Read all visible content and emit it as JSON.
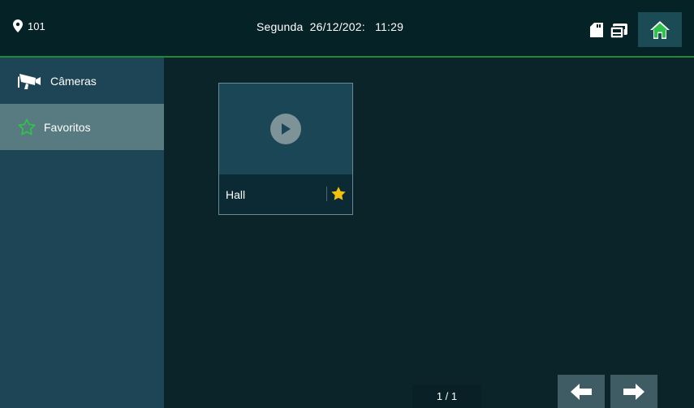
{
  "header": {
    "location": "101",
    "day": "Segunda",
    "date": "26/12/202:",
    "time": "11:29",
    "icons": [
      "location-pin-icon",
      "sd-card-icon",
      "intercom-icon",
      "home-icon"
    ]
  },
  "sidebar": {
    "items": [
      {
        "label": "Câmeras",
        "icon": "camera-icon",
        "active": false
      },
      {
        "label": "Favoritos",
        "icon": "star-outline-icon",
        "active": true
      }
    ]
  },
  "cards": [
    {
      "label": "Hall",
      "favorite": true,
      "icon": "play-icon"
    }
  ],
  "pager": {
    "text": "1 / 1"
  },
  "colors": {
    "accent_line": "#1f8a36",
    "star": "#f2c20f",
    "active_item": "#587a81"
  }
}
